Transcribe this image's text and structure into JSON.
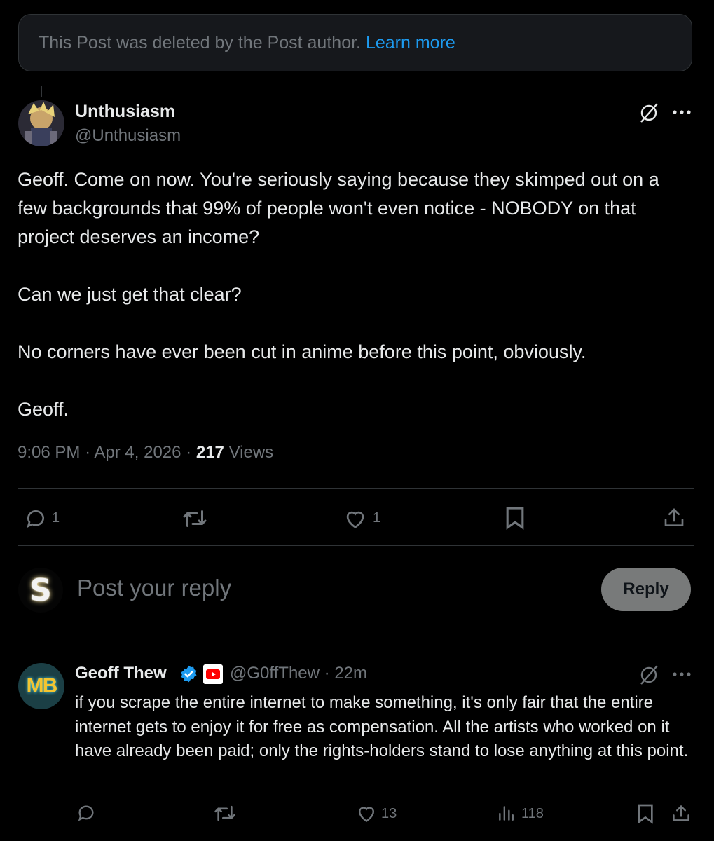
{
  "deleted_notice": {
    "text": "This Post was deleted by the Post author.",
    "link": "Learn more"
  },
  "post": {
    "author_name": "Unthusiasm",
    "author_handle": "@Unthusiasm",
    "paragraphs": [
      "Geoff. Come on now. You're seriously saying because they skimped out on a few backgrounds that 99% of people won't even notice - NOBODY on that project deserves an income?",
      "Can we just get that clear?",
      "No corners have ever been cut in anime before this point, obviously.",
      "Geoff."
    ],
    "time": "9:06 PM",
    "date": "Apr 4, 2026",
    "separator": "·",
    "views_count": "217",
    "views_label": "Views",
    "reply_count": "1",
    "like_count": "1"
  },
  "composer": {
    "avatar_letter": "S",
    "placeholder": "Post your reply",
    "button_label": "Reply"
  },
  "reply": {
    "avatar_text": "MB",
    "author_name": "Geoff Thew",
    "author_handle": "@G0ffThew",
    "separator": "·",
    "time_ago": "22m",
    "text": "if you scrape the entire internet to make something, it's only fair that the entire internet gets to enjoy it for free as compensation. All the artists who worked on it have already been paid; only the rights-holders stand to lose anything at this point.",
    "like_count": "13",
    "view_count": "118"
  },
  "icons": {
    "grok": "grok-icon",
    "more": "more-icon",
    "reply": "reply-icon",
    "repost": "repost-icon",
    "like": "heart-icon",
    "bookmark": "bookmark-icon",
    "share": "share-icon",
    "analytics": "analytics-icon",
    "verified": "verified-badge-icon",
    "affiliate": "youtube-affiliate-icon"
  },
  "colors": {
    "background": "#000000",
    "text": "#e7e9ea",
    "secondary": "#71767b",
    "link": "#1d9bf0",
    "border": "#2f3336",
    "reply_button": "#787a7a"
  }
}
